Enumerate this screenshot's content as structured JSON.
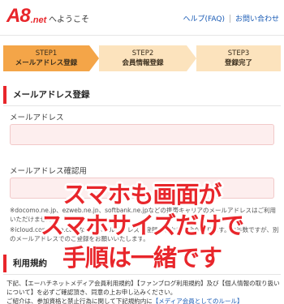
{
  "header": {
    "logo_main": "A8",
    "logo_sub": ".net",
    "welcome": "へようこそ",
    "help_link": "ヘルプ(FAQ)",
    "contact_link": "お問い合わせ"
  },
  "steps": [
    {
      "num": "STEP1",
      "label": "メールアドレス登録",
      "state": "current"
    },
    {
      "num": "STEP2",
      "label": "会員情報登録",
      "state": "upcoming"
    },
    {
      "num": "STEP3",
      "label": "登録完了",
      "state": "upcoming"
    }
  ],
  "email_section": {
    "title": "メールアドレス登録",
    "email_label": "メールアドレス",
    "email_value": "",
    "confirm_label": "メールアドレス確認用",
    "confirm_value": ""
  },
  "notes": {
    "docomo": "※docomo.ne.jp、ezweb.ne.jp、softbank.ne.jpなどの携帯キャリアのメールアドレスはご利用いただけません。",
    "icloud": "※icloud.com、me.comなどのメールアドレスは登録できない場合があります。お手数ですが、別のメールアドレスでのご登録をお願いいたします。"
  },
  "terms_section": {
    "title": "利用規約",
    "text1": "下記、【エーハチネットメディア会員利用規約】【ファンブログ利用規約】及び【個人情報の取り扱いについて】を必ずご確認頂き、同意の上お申し込みください。",
    "text2_prefix": "ご紹介は、参加資格と禁止行為に関して下記規約内に",
    "text2_link": "【メディア会員としてのルール】"
  },
  "overlay": {
    "line1": "スマホも画面が",
    "line2": "スマホサイズだけで",
    "line3": "手順は一緒です"
  },
  "colors": {
    "brand_red": "#e8262b",
    "step_active": "#f4a548",
    "step_inactive": "#fce3bd",
    "input_bg": "#fdeeee",
    "link_blue": "#1a5bb5"
  }
}
